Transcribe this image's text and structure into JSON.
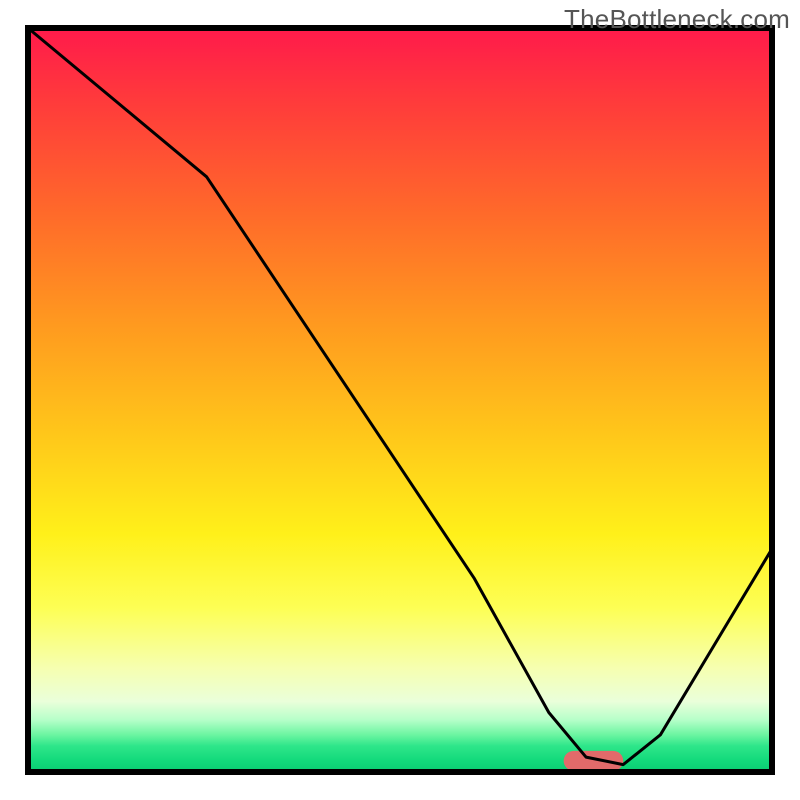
{
  "watermark": "TheBottleneck.com",
  "chart_data": {
    "type": "line",
    "title": "",
    "xlabel": "",
    "ylabel": "",
    "xlim": [
      0,
      100
    ],
    "ylim": [
      0,
      100
    ],
    "x": [
      0,
      12,
      24,
      36,
      48,
      60,
      70,
      75,
      80,
      85,
      100
    ],
    "values": [
      100,
      90,
      80,
      62,
      44,
      26,
      8,
      2,
      1,
      5,
      30
    ],
    "marker": {
      "x_center": 76,
      "x_halfwidth": 4,
      "y": 1.5
    },
    "annotations": []
  },
  "gradient_stops": [
    {
      "offset": 0.0,
      "color": "#ff1a4b"
    },
    {
      "offset": 0.1,
      "color": "#ff3b3b"
    },
    {
      "offset": 0.25,
      "color": "#ff6a2a"
    },
    {
      "offset": 0.4,
      "color": "#ff9a1f"
    },
    {
      "offset": 0.55,
      "color": "#ffc81a"
    },
    {
      "offset": 0.68,
      "color": "#fff01a"
    },
    {
      "offset": 0.78,
      "color": "#fdff55"
    },
    {
      "offset": 0.86,
      "color": "#f6ffb0"
    },
    {
      "offset": 0.905,
      "color": "#eaffda"
    },
    {
      "offset": 0.93,
      "color": "#b6ffc9"
    },
    {
      "offset": 0.95,
      "color": "#6cf5a1"
    },
    {
      "offset": 0.965,
      "color": "#2ee68a"
    },
    {
      "offset": 0.985,
      "color": "#12d97b"
    },
    {
      "offset": 1.0,
      "color": "#0acc72"
    }
  ],
  "marker_color": "#e26a6a"
}
